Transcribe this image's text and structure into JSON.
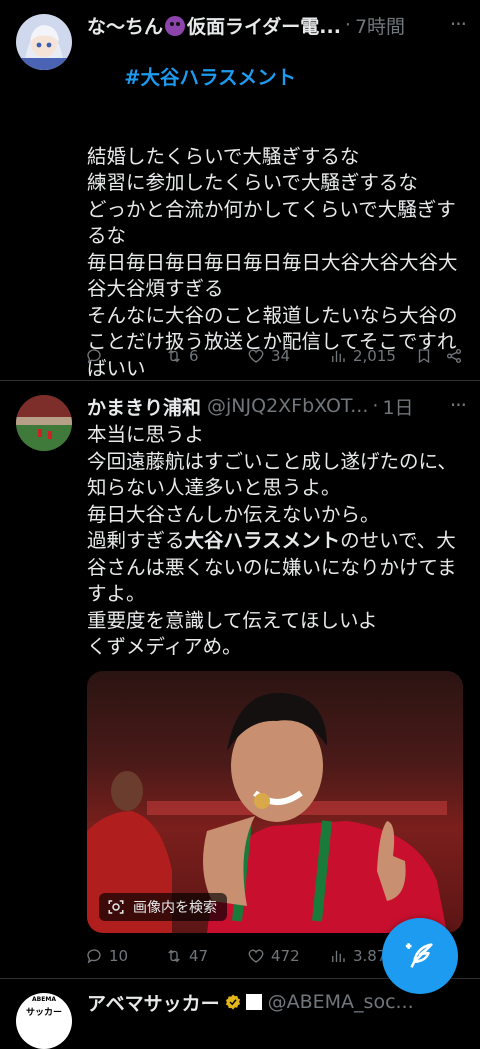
{
  "tweets": [
    {
      "name": "な〜ちん",
      "name_rest": "仮面ライダー電...",
      "time": "7時間",
      "hashtag": "#大谷ハラスメント",
      "text": "結婚したくらいで大騒ぎするな\n練習に参加したくらいで大騒ぎするな\nどっかと合流か何かしてくらいで大騒ぎするな\n毎日毎日毎日毎日毎日毎日大谷大谷大谷大谷大谷煩すぎる\nそんなに大谷のこと報道したいなら大谷のことだけ扱う放送とか配信してそこですればいい",
      "replies": "",
      "retweets": "6",
      "likes": "34",
      "views": "2,015"
    },
    {
      "name": "かまきり浦和",
      "handle": "@jNJQ2XFbXOT...",
      "time": "1日",
      "text_a": "本当に思うよ\n今回遠藤航はすごいこと成し遂げたのに、知らない人達多いと思うよ。\n毎日大谷さんしか伝えないから。\n過剰すぎる",
      "text_bold": "大谷ハラスメント",
      "text_b": "のせいで、大谷さんは悪くないのに嫌いになりかけてますよ。\n重要度を意識して伝えてほしいよ\nくずメディアめ。",
      "image_search_label": "画像内を検索",
      "replies": "10",
      "retweets": "47",
      "likes": "472",
      "views": "3.87"
    },
    {
      "name": "アベマサッカー",
      "handle": "@ABEMA_soc...",
      "avatar_top": "ABEMA",
      "avatar_text": "サッカー"
    }
  ],
  "colors": {
    "accent": "#1d9bf0",
    "muted": "#71767b",
    "text": "#e7e9ea"
  }
}
